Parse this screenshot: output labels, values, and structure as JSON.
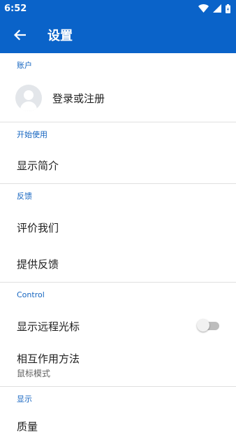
{
  "status_bar": {
    "time": "6:52",
    "icons": [
      "wifi-icon",
      "signal-icon",
      "battery-icon"
    ]
  },
  "app_bar": {
    "title": "设置",
    "back_icon": "arrow-left-icon"
  },
  "sections": {
    "account": {
      "header": "账户",
      "login_label": "登录或注册"
    },
    "getting_started": {
      "header": "开始使用",
      "intro_label": "显示简介"
    },
    "feedback": {
      "header": "反馈",
      "rate_label": "评价我们",
      "feedback_label": "提供反馈"
    },
    "control": {
      "header": "Control",
      "remote_cursor_label": "显示远程光标",
      "remote_cursor_enabled": false,
      "interaction_label": "相互作用方法",
      "interaction_value": "鼠标模式"
    },
    "display": {
      "header": "显示",
      "quality_label": "质量"
    }
  },
  "colors": {
    "primary": "#0a63c9",
    "section_header": "#1565c0"
  }
}
